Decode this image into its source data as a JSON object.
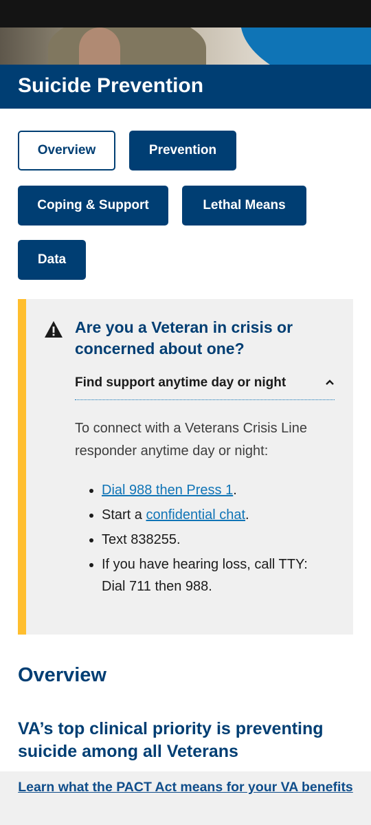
{
  "hero": {
    "image": "veteran-photo"
  },
  "page": {
    "title": "Suicide Prevention"
  },
  "tabs": [
    {
      "label": "Overview",
      "active": true
    },
    {
      "label": "Prevention",
      "active": false
    },
    {
      "label": "Coping & Support",
      "active": false
    },
    {
      "label": "Lethal Means",
      "active": false
    },
    {
      "label": "Data",
      "active": false
    }
  ],
  "crisis": {
    "icon": "warning-icon",
    "heading": "Are you a Veteran in crisis or concerned about one?",
    "accordion_label": "Find support anytime day or night",
    "accordion_icon": "chevron-up-icon",
    "intro": "To connect with a Veterans Crisis Line responder anytime day or night:",
    "items": {
      "dial_link": "Dial 988 then Press 1",
      "dial_suffix": ".",
      "chat_prefix": "Start a ",
      "chat_link": "confidential chat",
      "chat_suffix": ".",
      "text": "Text 838255.",
      "tty": "If you have hearing loss, call TTY: Dial 711 then 988."
    },
    "accent_color": "#ffbe2e"
  },
  "overview": {
    "heading": "Overview",
    "subheading": "VA’s top clinical priority is preventing suicide among all Veterans"
  },
  "banner": {
    "link": "Learn what the PACT Act means for your VA benefits"
  },
  "colors": {
    "primary": "#003e73",
    "link": "#0f74b6",
    "warning": "#ffbe2e"
  }
}
